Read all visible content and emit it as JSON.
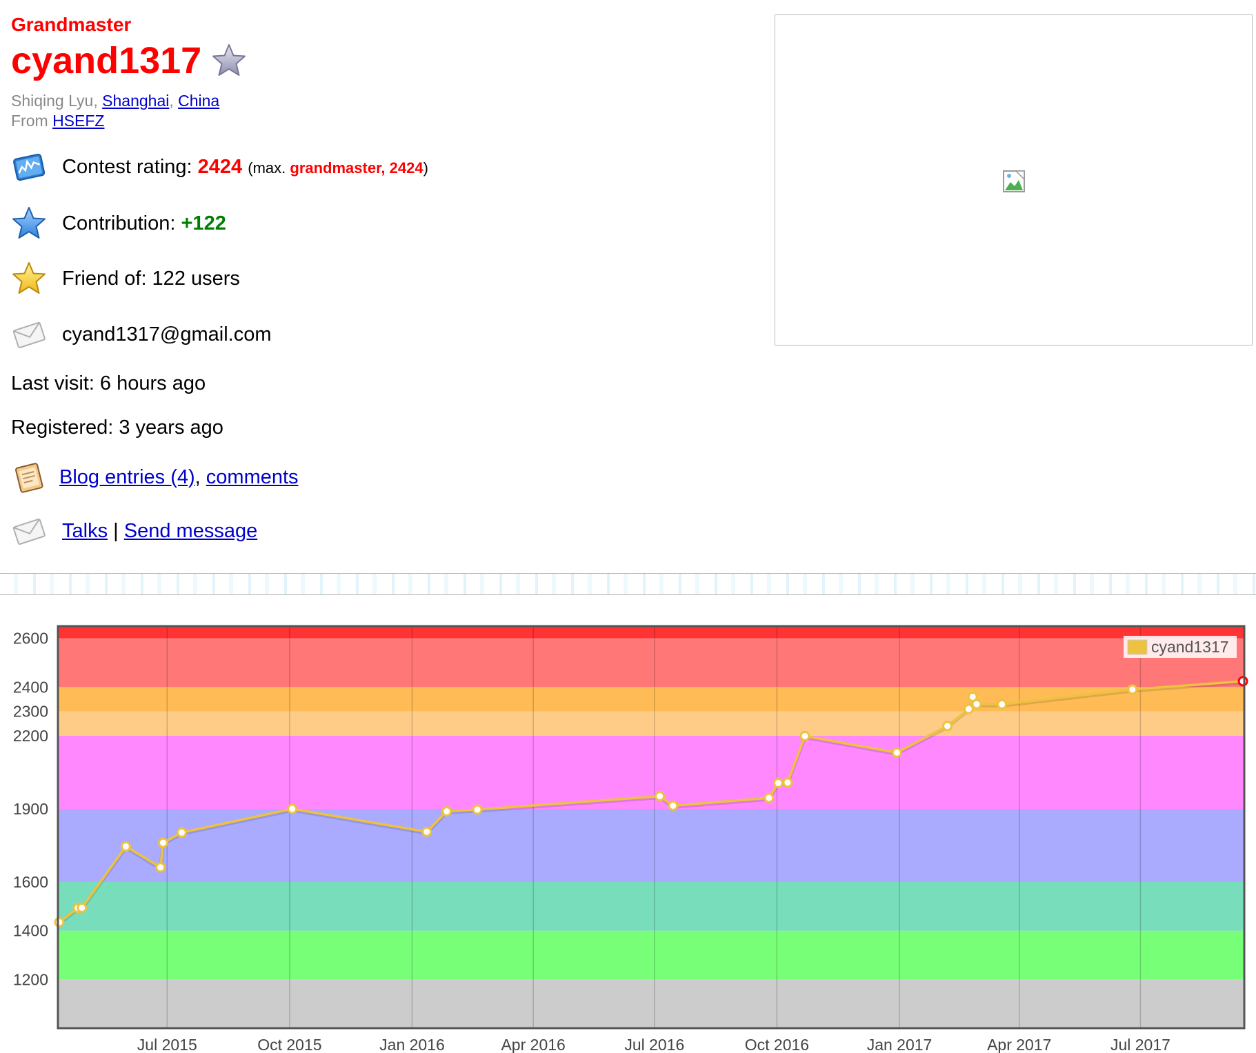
{
  "profile": {
    "rank": "Grandmaster",
    "handle": "cyand1317",
    "real_name": "Shiqing Lyu",
    "city": "Shanghai",
    "country": "China",
    "from_label": "From",
    "organization": "HSEFZ",
    "rating_label": "Contest rating:",
    "rating_value": "2424",
    "max_open": "(max.",
    "max_rank_value": "grandmaster, 2424",
    "max_close": ")",
    "contribution_label": "Contribution:",
    "contribution_value": "+122",
    "friends_text": "Friend of: 122 users",
    "email": "cyand1317@gmail.com",
    "last_visit": "Last visit: 6 hours ago",
    "registered": "Registered: 3 years ago",
    "blog_link": "Blog entries (4)",
    "comments_link": "comments",
    "talks_link": "Talks",
    "send_message_link": "Send message",
    "sep_comma": ",",
    "sep_pipe": "|"
  },
  "icons": {
    "rating": "rating-chart-icon",
    "contribution": "blue-star-icon",
    "friends": "gold-star-icon",
    "email": "envelope-icon",
    "blog": "notepad-icon",
    "talks": "envelope-icon",
    "favorite": "favorite-star-icon",
    "avatar": "broken-image-icon"
  },
  "colors": {
    "rank": "#ff0000",
    "contribution": "#008000",
    "link": "#0000cc",
    "series": "#edc240"
  },
  "chart_data": {
    "type": "line",
    "series": [
      {
        "name": "cyand1317",
        "points": [
          [
            "2015-04-11",
            1435
          ],
          [
            "2015-04-25",
            1493
          ],
          [
            "2015-04-28",
            1494
          ],
          [
            "2015-05-31",
            1746
          ],
          [
            "2015-06-26",
            1660
          ],
          [
            "2015-06-28",
            1761
          ],
          [
            "2015-07-12",
            1803
          ],
          [
            "2015-10-03",
            1900
          ],
          [
            "2016-01-12",
            1806
          ],
          [
            "2016-01-27",
            1890
          ],
          [
            "2016-02-19",
            1897
          ],
          [
            "2016-07-05",
            1952
          ],
          [
            "2016-07-15",
            1913
          ],
          [
            "2016-09-25",
            1945
          ],
          [
            "2016-10-02",
            2006
          ],
          [
            "2016-10-09",
            2008
          ],
          [
            "2016-10-22",
            2199
          ],
          [
            "2016-12-30",
            2131
          ],
          [
            "2017-02-06",
            2240
          ],
          [
            "2017-02-22",
            2310
          ],
          [
            "2017-02-25",
            2360
          ],
          [
            "2017-02-28",
            2330
          ],
          [
            "2017-03-19",
            2329
          ],
          [
            "2017-06-25",
            2390
          ],
          [
            "2017-09-16",
            2424
          ]
        ],
        "last_point_color": "#ff0000"
      }
    ],
    "ylim": [
      1000,
      2650
    ],
    "xlim": [
      "2015-04-10",
      "2017-09-17"
    ],
    "y_ticks": [
      1200,
      1400,
      1600,
      1900,
      2200,
      2300,
      2400,
      2600
    ],
    "x_ticks": [
      "Jul 2015",
      "Oct 2015",
      "Jan 2016",
      "Apr 2016",
      "Jul 2016",
      "Oct 2016",
      "Jan 2017",
      "Apr 2017",
      "Jul 2017"
    ],
    "bands": [
      {
        "from": 1000,
        "to": 1200,
        "color": "#cccccc"
      },
      {
        "from": 1200,
        "to": 1400,
        "color": "#77ff77"
      },
      {
        "from": 1400,
        "to": 1600,
        "color": "#77ddbb"
      },
      {
        "from": 1600,
        "to": 1900,
        "color": "#aaaaff"
      },
      {
        "from": 1900,
        "to": 2200,
        "color": "#ff88ff"
      },
      {
        "from": 2200,
        "to": 2300,
        "color": "#ffcc88"
      },
      {
        "from": 2300,
        "to": 2400,
        "color": "#ffbb55"
      },
      {
        "from": 2400,
        "to": 2600,
        "color": "#ff7777"
      },
      {
        "from": 2600,
        "to": 2650,
        "color": "#ff3333"
      }
    ],
    "legend": "top-right",
    "grid": true
  }
}
